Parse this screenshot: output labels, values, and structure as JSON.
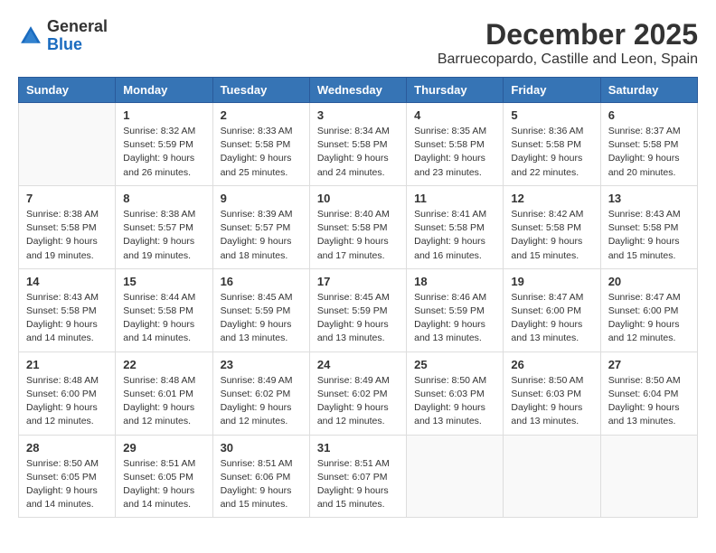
{
  "logo": {
    "general": "General",
    "blue": "Blue"
  },
  "title": "December 2025",
  "subtitle": "Barruecopardo, Castille and Leon, Spain",
  "weekdays": [
    "Sunday",
    "Monday",
    "Tuesday",
    "Wednesday",
    "Thursday",
    "Friday",
    "Saturday"
  ],
  "weeks": [
    [
      {
        "day": "",
        "info": ""
      },
      {
        "day": "1",
        "info": "Sunrise: 8:32 AM\nSunset: 5:59 PM\nDaylight: 9 hours\nand 26 minutes."
      },
      {
        "day": "2",
        "info": "Sunrise: 8:33 AM\nSunset: 5:58 PM\nDaylight: 9 hours\nand 25 minutes."
      },
      {
        "day": "3",
        "info": "Sunrise: 8:34 AM\nSunset: 5:58 PM\nDaylight: 9 hours\nand 24 minutes."
      },
      {
        "day": "4",
        "info": "Sunrise: 8:35 AM\nSunset: 5:58 PM\nDaylight: 9 hours\nand 23 minutes."
      },
      {
        "day": "5",
        "info": "Sunrise: 8:36 AM\nSunset: 5:58 PM\nDaylight: 9 hours\nand 22 minutes."
      },
      {
        "day": "6",
        "info": "Sunrise: 8:37 AM\nSunset: 5:58 PM\nDaylight: 9 hours\nand 20 minutes."
      }
    ],
    [
      {
        "day": "7",
        "info": "Sunrise: 8:38 AM\nSunset: 5:58 PM\nDaylight: 9 hours\nand 19 minutes."
      },
      {
        "day": "8",
        "info": "Sunrise: 8:38 AM\nSunset: 5:57 PM\nDaylight: 9 hours\nand 19 minutes."
      },
      {
        "day": "9",
        "info": "Sunrise: 8:39 AM\nSunset: 5:57 PM\nDaylight: 9 hours\nand 18 minutes."
      },
      {
        "day": "10",
        "info": "Sunrise: 8:40 AM\nSunset: 5:58 PM\nDaylight: 9 hours\nand 17 minutes."
      },
      {
        "day": "11",
        "info": "Sunrise: 8:41 AM\nSunset: 5:58 PM\nDaylight: 9 hours\nand 16 minutes."
      },
      {
        "day": "12",
        "info": "Sunrise: 8:42 AM\nSunset: 5:58 PM\nDaylight: 9 hours\nand 15 minutes."
      },
      {
        "day": "13",
        "info": "Sunrise: 8:43 AM\nSunset: 5:58 PM\nDaylight: 9 hours\nand 15 minutes."
      }
    ],
    [
      {
        "day": "14",
        "info": "Sunrise: 8:43 AM\nSunset: 5:58 PM\nDaylight: 9 hours\nand 14 minutes."
      },
      {
        "day": "15",
        "info": "Sunrise: 8:44 AM\nSunset: 5:58 PM\nDaylight: 9 hours\nand 14 minutes."
      },
      {
        "day": "16",
        "info": "Sunrise: 8:45 AM\nSunset: 5:59 PM\nDaylight: 9 hours\nand 13 minutes."
      },
      {
        "day": "17",
        "info": "Sunrise: 8:45 AM\nSunset: 5:59 PM\nDaylight: 9 hours\nand 13 minutes."
      },
      {
        "day": "18",
        "info": "Sunrise: 8:46 AM\nSunset: 5:59 PM\nDaylight: 9 hours\nand 13 minutes."
      },
      {
        "day": "19",
        "info": "Sunrise: 8:47 AM\nSunset: 6:00 PM\nDaylight: 9 hours\nand 13 minutes."
      },
      {
        "day": "20",
        "info": "Sunrise: 8:47 AM\nSunset: 6:00 PM\nDaylight: 9 hours\nand 12 minutes."
      }
    ],
    [
      {
        "day": "21",
        "info": "Sunrise: 8:48 AM\nSunset: 6:00 PM\nDaylight: 9 hours\nand 12 minutes."
      },
      {
        "day": "22",
        "info": "Sunrise: 8:48 AM\nSunset: 6:01 PM\nDaylight: 9 hours\nand 12 minutes."
      },
      {
        "day": "23",
        "info": "Sunrise: 8:49 AM\nSunset: 6:02 PM\nDaylight: 9 hours\nand 12 minutes."
      },
      {
        "day": "24",
        "info": "Sunrise: 8:49 AM\nSunset: 6:02 PM\nDaylight: 9 hours\nand 12 minutes."
      },
      {
        "day": "25",
        "info": "Sunrise: 8:50 AM\nSunset: 6:03 PM\nDaylight: 9 hours\nand 13 minutes."
      },
      {
        "day": "26",
        "info": "Sunrise: 8:50 AM\nSunset: 6:03 PM\nDaylight: 9 hours\nand 13 minutes."
      },
      {
        "day": "27",
        "info": "Sunrise: 8:50 AM\nSunset: 6:04 PM\nDaylight: 9 hours\nand 13 minutes."
      }
    ],
    [
      {
        "day": "28",
        "info": "Sunrise: 8:50 AM\nSunset: 6:05 PM\nDaylight: 9 hours\nand 14 minutes."
      },
      {
        "day": "29",
        "info": "Sunrise: 8:51 AM\nSunset: 6:05 PM\nDaylight: 9 hours\nand 14 minutes."
      },
      {
        "day": "30",
        "info": "Sunrise: 8:51 AM\nSunset: 6:06 PM\nDaylight: 9 hours\nand 15 minutes."
      },
      {
        "day": "31",
        "info": "Sunrise: 8:51 AM\nSunset: 6:07 PM\nDaylight: 9 hours\nand 15 minutes."
      },
      {
        "day": "",
        "info": ""
      },
      {
        "day": "",
        "info": ""
      },
      {
        "day": "",
        "info": ""
      }
    ]
  ]
}
